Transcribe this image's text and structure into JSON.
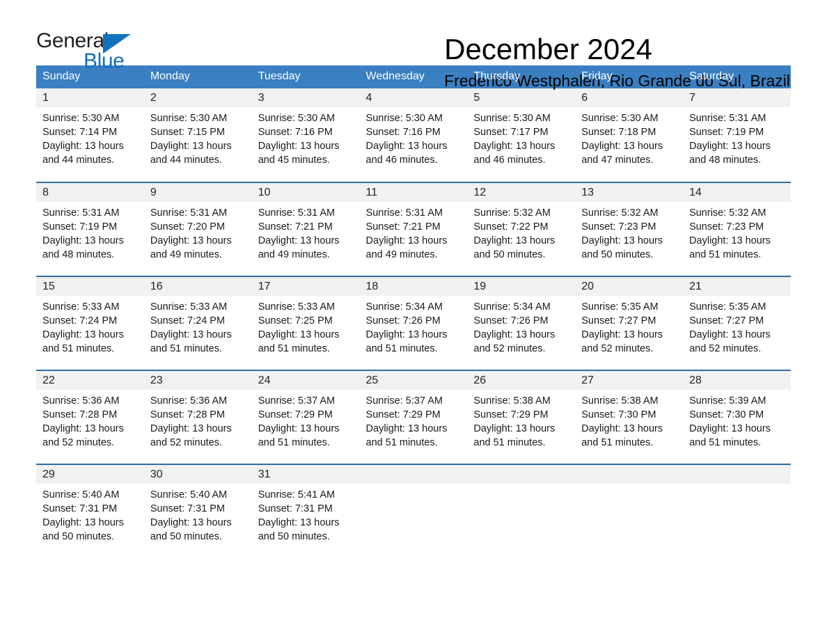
{
  "brand": {
    "name_part1": "General",
    "name_part2": "Blue",
    "triangle_color": "#1273bd",
    "blue_text_color": "#0f6fc0"
  },
  "header": {
    "title": "December 2024",
    "location": "Frederico Westphalen, Rio Grande do Sul, Brazil"
  },
  "theme": {
    "header_bg": "#3a7fc1",
    "row_border": "#2e6da4",
    "daynum_bg": "#f1f1f1"
  },
  "calendar": {
    "weekday_headers": [
      "Sunday",
      "Monday",
      "Tuesday",
      "Wednesday",
      "Thursday",
      "Friday",
      "Saturday"
    ],
    "weeks": [
      [
        {
          "day": "1",
          "sunrise": "Sunrise: 5:30 AM",
          "sunset": "Sunset: 7:14 PM",
          "daylight_line1": "Daylight: 13 hours",
          "daylight_line2": "and 44 minutes."
        },
        {
          "day": "2",
          "sunrise": "Sunrise: 5:30 AM",
          "sunset": "Sunset: 7:15 PM",
          "daylight_line1": "Daylight: 13 hours",
          "daylight_line2": "and 44 minutes."
        },
        {
          "day": "3",
          "sunrise": "Sunrise: 5:30 AM",
          "sunset": "Sunset: 7:16 PM",
          "daylight_line1": "Daylight: 13 hours",
          "daylight_line2": "and 45 minutes."
        },
        {
          "day": "4",
          "sunrise": "Sunrise: 5:30 AM",
          "sunset": "Sunset: 7:16 PM",
          "daylight_line1": "Daylight: 13 hours",
          "daylight_line2": "and 46 minutes."
        },
        {
          "day": "5",
          "sunrise": "Sunrise: 5:30 AM",
          "sunset": "Sunset: 7:17 PM",
          "daylight_line1": "Daylight: 13 hours",
          "daylight_line2": "and 46 minutes."
        },
        {
          "day": "6",
          "sunrise": "Sunrise: 5:30 AM",
          "sunset": "Sunset: 7:18 PM",
          "daylight_line1": "Daylight: 13 hours",
          "daylight_line2": "and 47 minutes."
        },
        {
          "day": "7",
          "sunrise": "Sunrise: 5:31 AM",
          "sunset": "Sunset: 7:19 PM",
          "daylight_line1": "Daylight: 13 hours",
          "daylight_line2": "and 48 minutes."
        }
      ],
      [
        {
          "day": "8",
          "sunrise": "Sunrise: 5:31 AM",
          "sunset": "Sunset: 7:19 PM",
          "daylight_line1": "Daylight: 13 hours",
          "daylight_line2": "and 48 minutes."
        },
        {
          "day": "9",
          "sunrise": "Sunrise: 5:31 AM",
          "sunset": "Sunset: 7:20 PM",
          "daylight_line1": "Daylight: 13 hours",
          "daylight_line2": "and 49 minutes."
        },
        {
          "day": "10",
          "sunrise": "Sunrise: 5:31 AM",
          "sunset": "Sunset: 7:21 PM",
          "daylight_line1": "Daylight: 13 hours",
          "daylight_line2": "and 49 minutes."
        },
        {
          "day": "11",
          "sunrise": "Sunrise: 5:31 AM",
          "sunset": "Sunset: 7:21 PM",
          "daylight_line1": "Daylight: 13 hours",
          "daylight_line2": "and 49 minutes."
        },
        {
          "day": "12",
          "sunrise": "Sunrise: 5:32 AM",
          "sunset": "Sunset: 7:22 PM",
          "daylight_line1": "Daylight: 13 hours",
          "daylight_line2": "and 50 minutes."
        },
        {
          "day": "13",
          "sunrise": "Sunrise: 5:32 AM",
          "sunset": "Sunset: 7:23 PM",
          "daylight_line1": "Daylight: 13 hours",
          "daylight_line2": "and 50 minutes."
        },
        {
          "day": "14",
          "sunrise": "Sunrise: 5:32 AM",
          "sunset": "Sunset: 7:23 PM",
          "daylight_line1": "Daylight: 13 hours",
          "daylight_line2": "and 51 minutes."
        }
      ],
      [
        {
          "day": "15",
          "sunrise": "Sunrise: 5:33 AM",
          "sunset": "Sunset: 7:24 PM",
          "daylight_line1": "Daylight: 13 hours",
          "daylight_line2": "and 51 minutes."
        },
        {
          "day": "16",
          "sunrise": "Sunrise: 5:33 AM",
          "sunset": "Sunset: 7:24 PM",
          "daylight_line1": "Daylight: 13 hours",
          "daylight_line2": "and 51 minutes."
        },
        {
          "day": "17",
          "sunrise": "Sunrise: 5:33 AM",
          "sunset": "Sunset: 7:25 PM",
          "daylight_line1": "Daylight: 13 hours",
          "daylight_line2": "and 51 minutes."
        },
        {
          "day": "18",
          "sunrise": "Sunrise: 5:34 AM",
          "sunset": "Sunset: 7:26 PM",
          "daylight_line1": "Daylight: 13 hours",
          "daylight_line2": "and 51 minutes."
        },
        {
          "day": "19",
          "sunrise": "Sunrise: 5:34 AM",
          "sunset": "Sunset: 7:26 PM",
          "daylight_line1": "Daylight: 13 hours",
          "daylight_line2": "and 52 minutes."
        },
        {
          "day": "20",
          "sunrise": "Sunrise: 5:35 AM",
          "sunset": "Sunset: 7:27 PM",
          "daylight_line1": "Daylight: 13 hours",
          "daylight_line2": "and 52 minutes."
        },
        {
          "day": "21",
          "sunrise": "Sunrise: 5:35 AM",
          "sunset": "Sunset: 7:27 PM",
          "daylight_line1": "Daylight: 13 hours",
          "daylight_line2": "and 52 minutes."
        }
      ],
      [
        {
          "day": "22",
          "sunrise": "Sunrise: 5:36 AM",
          "sunset": "Sunset: 7:28 PM",
          "daylight_line1": "Daylight: 13 hours",
          "daylight_line2": "and 52 minutes."
        },
        {
          "day": "23",
          "sunrise": "Sunrise: 5:36 AM",
          "sunset": "Sunset: 7:28 PM",
          "daylight_line1": "Daylight: 13 hours",
          "daylight_line2": "and 52 minutes."
        },
        {
          "day": "24",
          "sunrise": "Sunrise: 5:37 AM",
          "sunset": "Sunset: 7:29 PM",
          "daylight_line1": "Daylight: 13 hours",
          "daylight_line2": "and 51 minutes."
        },
        {
          "day": "25",
          "sunrise": "Sunrise: 5:37 AM",
          "sunset": "Sunset: 7:29 PM",
          "daylight_line1": "Daylight: 13 hours",
          "daylight_line2": "and 51 minutes."
        },
        {
          "day": "26",
          "sunrise": "Sunrise: 5:38 AM",
          "sunset": "Sunset: 7:29 PM",
          "daylight_line1": "Daylight: 13 hours",
          "daylight_line2": "and 51 minutes."
        },
        {
          "day": "27",
          "sunrise": "Sunrise: 5:38 AM",
          "sunset": "Sunset: 7:30 PM",
          "daylight_line1": "Daylight: 13 hours",
          "daylight_line2": "and 51 minutes."
        },
        {
          "day": "28",
          "sunrise": "Sunrise: 5:39 AM",
          "sunset": "Sunset: 7:30 PM",
          "daylight_line1": "Daylight: 13 hours",
          "daylight_line2": "and 51 minutes."
        }
      ],
      [
        {
          "day": "29",
          "sunrise": "Sunrise: 5:40 AM",
          "sunset": "Sunset: 7:31 PM",
          "daylight_line1": "Daylight: 13 hours",
          "daylight_line2": "and 50 minutes."
        },
        {
          "day": "30",
          "sunrise": "Sunrise: 5:40 AM",
          "sunset": "Sunset: 7:31 PM",
          "daylight_line1": "Daylight: 13 hours",
          "daylight_line2": "and 50 minutes."
        },
        {
          "day": "31",
          "sunrise": "Sunrise: 5:41 AM",
          "sunset": "Sunset: 7:31 PM",
          "daylight_line1": "Daylight: 13 hours",
          "daylight_line2": "and 50 minutes."
        },
        {
          "day": "",
          "sunrise": "",
          "sunset": "",
          "daylight_line1": "",
          "daylight_line2": ""
        },
        {
          "day": "",
          "sunrise": "",
          "sunset": "",
          "daylight_line1": "",
          "daylight_line2": ""
        },
        {
          "day": "",
          "sunrise": "",
          "sunset": "",
          "daylight_line1": "",
          "daylight_line2": ""
        },
        {
          "day": "",
          "sunrise": "",
          "sunset": "",
          "daylight_line1": "",
          "daylight_line2": ""
        }
      ]
    ]
  }
}
